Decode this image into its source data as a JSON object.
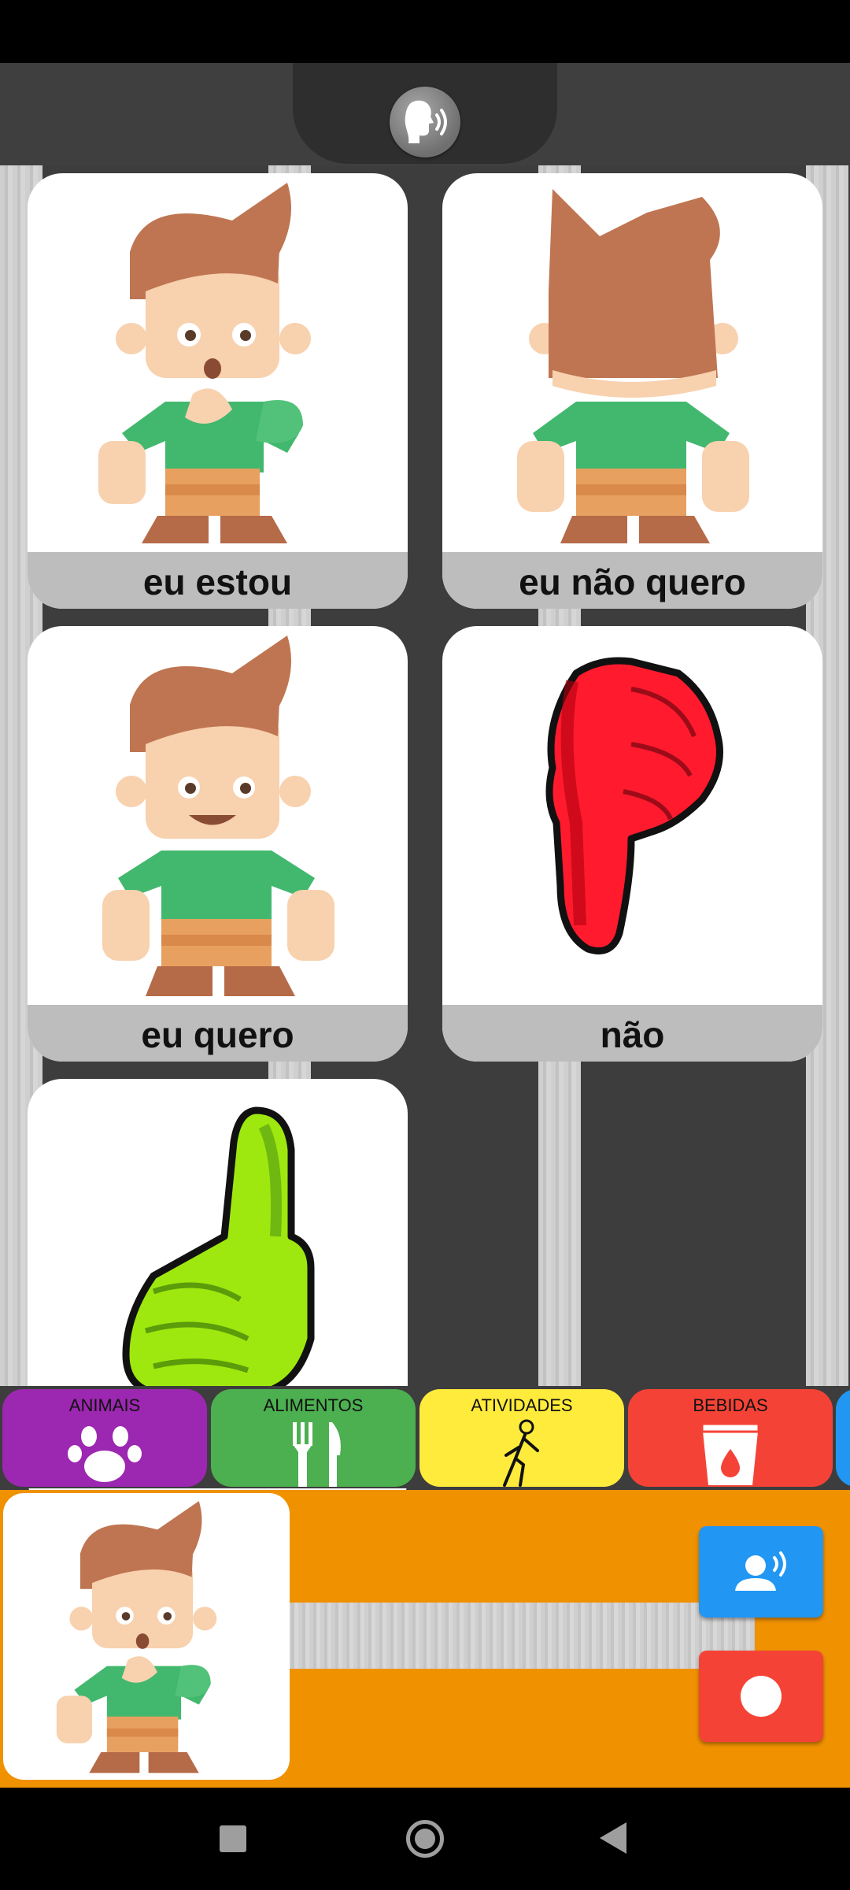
{
  "cards": [
    {
      "label": "eu estou",
      "icon": "boy-thinking-icon"
    },
    {
      "label": "eu não quero",
      "icon": "boy-back-icon"
    },
    {
      "label": "eu quero",
      "icon": "boy-smiling-icon"
    },
    {
      "label": "não",
      "icon": "thumbs-down-icon"
    },
    {
      "label": "",
      "icon": "thumbs-up-icon"
    }
  ],
  "categories": [
    {
      "label": "ANIMAIS",
      "color": "#9c27b0",
      "icon": "paw-icon"
    },
    {
      "label": "ALIMENTOS",
      "color": "#4caf50",
      "icon": "fork-knife-icon"
    },
    {
      "label": "ATIVIDADES",
      "color": "#ffeb3b",
      "icon": "walking-person-icon"
    },
    {
      "label": "BEBIDAS",
      "color": "#f44336",
      "icon": "cup-icon"
    }
  ],
  "colors": {
    "background": "#3d3d3d",
    "tray": "#f09100",
    "speak_button": "#2196f3",
    "record_button": "#f44336"
  },
  "selected_symbol": {
    "icon": "boy-thinking-icon"
  }
}
